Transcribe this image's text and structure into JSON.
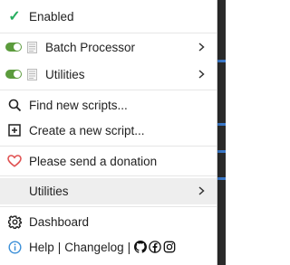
{
  "menu": {
    "enabled_label": "Enabled",
    "scripts": [
      {
        "name": "Batch Processor",
        "enabled": true
      },
      {
        "name": "Utilities",
        "enabled": true
      }
    ],
    "find_scripts_label": "Find new scripts...",
    "create_script_label": "Create a new script...",
    "donation_label": "Please send a donation",
    "utilities_submenu_label": "Utilities",
    "dashboard_label": "Dashboard",
    "help_label": "Help",
    "divider": "|",
    "changelog_label": "Changelog",
    "divider2": "|"
  },
  "colors": {
    "check": "#27ae60",
    "toggle_on": "#5b9b3c",
    "heart": "#e05252",
    "info": "#3a8fd8"
  },
  "icons": {
    "enabled": "check-icon",
    "find": "search-icon",
    "create": "plus-square-icon",
    "donate": "heart-icon",
    "dashboard": "gear-icon",
    "help": "info-icon",
    "social": [
      "github-icon",
      "facebook-icon",
      "instagram-icon"
    ]
  }
}
